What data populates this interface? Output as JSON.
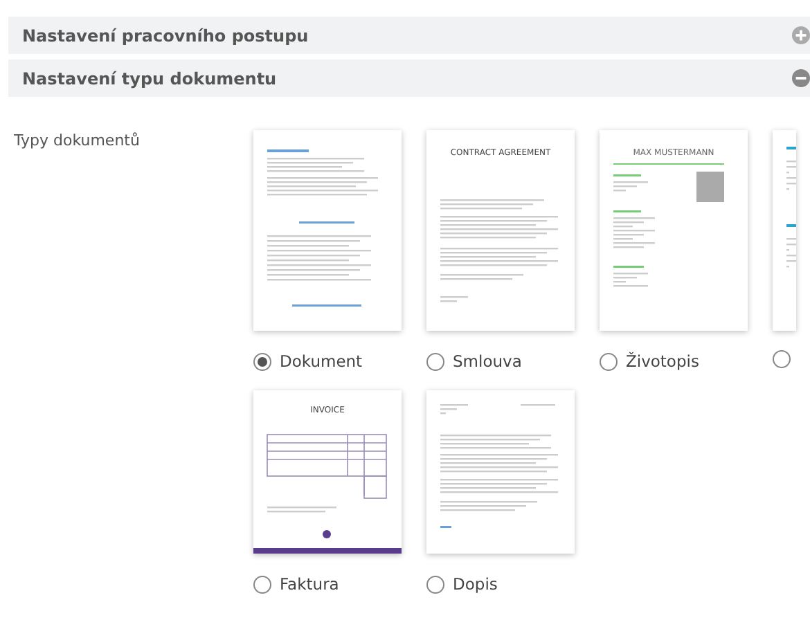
{
  "sections": [
    {
      "title": "Nastavení pracovního postupu",
      "expanded": false
    },
    {
      "title": "Nastavení typu dokumentu",
      "expanded": true
    }
  ],
  "document_types": {
    "label": "Typy dokumentů",
    "items": [
      {
        "kind": "document",
        "label": "Dokument",
        "selected": true
      },
      {
        "kind": "contract",
        "heading": "CONTRACT AGREEMENT",
        "label": "Smlouva",
        "selected": false
      },
      {
        "kind": "resume",
        "heading": "MAX MUSTERMANN",
        "label": "Životopis",
        "selected": false
      },
      {
        "kind": "report",
        "selected": false
      },
      {
        "kind": "invoice",
        "heading": "INVOICE",
        "label": "Faktura",
        "selected": false
      },
      {
        "kind": "letter",
        "label": "Dopis",
        "selected": false
      }
    ]
  }
}
